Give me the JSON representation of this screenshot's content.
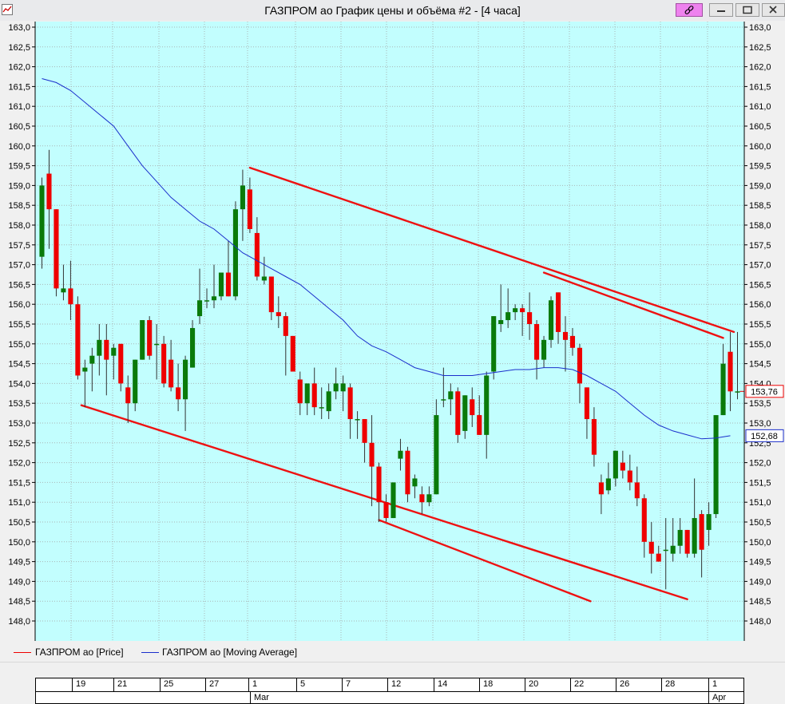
{
  "window": {
    "title": "ГАЗПРОМ ао График цены и объёма #2 - [4 часа]",
    "pin_icon": "link-icon",
    "minimize_icon": "minimize-icon",
    "maximize_icon": "restore-icon",
    "close_icon": "close-icon"
  },
  "legend": {
    "price_label": "ГАЗПРОМ ао [Price]",
    "ma_label": "ГАЗПРОМ ао [Moving Average]"
  },
  "colors": {
    "background": "#c2fefe",
    "up": "#0a7a0a",
    "down": "#ee0000",
    "ma": "#1a2ecc",
    "trendline": "#ee1111"
  },
  "chart_data": {
    "type": "candlestick",
    "ylim": [
      148.0,
      163.0
    ],
    "y_ticks": [
      "148,0",
      "148,5",
      "149,0",
      "149,5",
      "150,0",
      "150,5",
      "151,0",
      "151,5",
      "152,0",
      "152,5",
      "153,0",
      "153,5",
      "154,0",
      "154,5",
      "155,0",
      "155,5",
      "156,0",
      "156,5",
      "157,0",
      "157,5",
      "158,0",
      "158,5",
      "159,0",
      "159,5",
      "160,0",
      "160,5",
      "161,0",
      "161,5",
      "162,0",
      "162,5",
      "163,0"
    ],
    "x_day_labels": [
      "19",
      "21",
      "25",
      "27",
      "1",
      "5",
      "7",
      "12",
      "14",
      "18",
      "20",
      "22",
      "26",
      "28",
      "1"
    ],
    "x_month_labels": [
      "Mar",
      "Apr"
    ],
    "last_price_label": "153,76",
    "last_ma_label": "152,68",
    "grid": true,
    "candles": [
      {
        "o": 157.2,
        "h": 159.2,
        "l": 156.9,
        "c": 159.0
      },
      {
        "o": 159.3,
        "h": 159.9,
        "l": 157.4,
        "c": 158.4
      },
      {
        "o": 158.4,
        "h": 158.4,
        "l": 156.2,
        "c": 156.4
      },
      {
        "o": 156.3,
        "h": 157.0,
        "l": 156.1,
        "c": 156.4
      },
      {
        "o": 156.4,
        "h": 157.1,
        "l": 155.6,
        "c": 156.0
      },
      {
        "o": 156.0,
        "h": 156.2,
        "l": 154.1,
        "c": 154.2
      },
      {
        "o": 154.3,
        "h": 154.6,
        "l": 153.4,
        "c": 154.4
      },
      {
        "o": 154.5,
        "h": 154.9,
        "l": 153.8,
        "c": 154.7
      },
      {
        "o": 154.7,
        "h": 155.5,
        "l": 154.2,
        "c": 155.1
      },
      {
        "o": 155.1,
        "h": 155.5,
        "l": 153.7,
        "c": 154.6
      },
      {
        "o": 154.7,
        "h": 155.0,
        "l": 154.1,
        "c": 154.9
      },
      {
        "o": 155.0,
        "h": 155.0,
        "l": 153.8,
        "c": 154.0
      },
      {
        "o": 153.9,
        "h": 154.2,
        "l": 153.0,
        "c": 153.5
      },
      {
        "o": 153.5,
        "h": 154.6,
        "l": 153.3,
        "c": 154.6
      },
      {
        "o": 154.6,
        "h": 155.6,
        "l": 154.6,
        "c": 155.6
      },
      {
        "o": 155.6,
        "h": 155.7,
        "l": 154.6,
        "c": 154.7
      },
      {
        "o": 155.0,
        "h": 155.5,
        "l": 154.1,
        "c": 155.0
      },
      {
        "o": 155.0,
        "h": 155.2,
        "l": 153.9,
        "c": 154.0
      },
      {
        "o": 154.6,
        "h": 155.1,
        "l": 153.8,
        "c": 153.9
      },
      {
        "o": 153.9,
        "h": 154.5,
        "l": 153.3,
        "c": 153.6
      },
      {
        "o": 153.6,
        "h": 154.7,
        "l": 152.8,
        "c": 154.6
      },
      {
        "o": 154.4,
        "h": 155.6,
        "l": 154.4,
        "c": 155.4
      },
      {
        "o": 155.7,
        "h": 156.9,
        "l": 155.5,
        "c": 156.1
      },
      {
        "o": 156.1,
        "h": 156.4,
        "l": 155.9,
        "c": 156.1
      },
      {
        "o": 156.1,
        "h": 157.0,
        "l": 155.9,
        "c": 156.2
      },
      {
        "o": 156.2,
        "h": 156.8,
        "l": 156.1,
        "c": 156.8
      },
      {
        "o": 156.8,
        "h": 157.6,
        "l": 156.2,
        "c": 156.2
      },
      {
        "o": 156.2,
        "h": 158.6,
        "l": 156.1,
        "c": 158.4
      },
      {
        "o": 158.4,
        "h": 159.4,
        "l": 157.6,
        "c": 159.0
      },
      {
        "o": 158.9,
        "h": 159.2,
        "l": 157.8,
        "c": 157.9
      },
      {
        "o": 157.8,
        "h": 158.2,
        "l": 156.6,
        "c": 156.7
      },
      {
        "o": 156.6,
        "h": 157.2,
        "l": 156.5,
        "c": 156.7
      },
      {
        "o": 156.7,
        "h": 156.7,
        "l": 155.6,
        "c": 155.8
      },
      {
        "o": 155.8,
        "h": 156.2,
        "l": 155.4,
        "c": 155.7
      },
      {
        "o": 155.7,
        "h": 155.8,
        "l": 154.2,
        "c": 155.2
      },
      {
        "o": 155.2,
        "h": 155.2,
        "l": 154.3,
        "c": 154.3
      },
      {
        "o": 154.1,
        "h": 154.3,
        "l": 153.2,
        "c": 153.5
      },
      {
        "o": 153.5,
        "h": 154.0,
        "l": 153.2,
        "c": 154.0
      },
      {
        "o": 154.0,
        "h": 154.4,
        "l": 153.2,
        "c": 153.4
      },
      {
        "o": 153.4,
        "h": 153.9,
        "l": 153.1,
        "c": 153.4
      },
      {
        "o": 153.3,
        "h": 154.0,
        "l": 153.1,
        "c": 153.8
      },
      {
        "o": 153.8,
        "h": 154.4,
        "l": 153.6,
        "c": 154.0
      },
      {
        "o": 153.8,
        "h": 154.2,
        "l": 153.3,
        "c": 154.0
      },
      {
        "o": 153.9,
        "h": 154.0,
        "l": 152.6,
        "c": 153.1
      },
      {
        "o": 153.1,
        "h": 153.3,
        "l": 152.6,
        "c": 153.1
      },
      {
        "o": 153.1,
        "h": 153.1,
        "l": 152.0,
        "c": 152.5
      },
      {
        "o": 152.5,
        "h": 153.2,
        "l": 150.9,
        "c": 151.9
      },
      {
        "o": 151.9,
        "h": 152.0,
        "l": 150.5,
        "c": 151.0
      },
      {
        "o": 151.0,
        "h": 151.2,
        "l": 150.5,
        "c": 150.6
      },
      {
        "o": 150.6,
        "h": 151.5,
        "l": 150.6,
        "c": 151.5
      },
      {
        "o": 152.1,
        "h": 152.6,
        "l": 151.8,
        "c": 152.3
      },
      {
        "o": 152.3,
        "h": 152.4,
        "l": 151.0,
        "c": 151.2
      },
      {
        "o": 151.4,
        "h": 151.7,
        "l": 151.1,
        "c": 151.6
      },
      {
        "o": 151.2,
        "h": 151.4,
        "l": 150.7,
        "c": 151.0
      },
      {
        "o": 151.0,
        "h": 151.4,
        "l": 150.9,
        "c": 151.2
      },
      {
        "o": 151.2,
        "h": 153.6,
        "l": 151.2,
        "c": 153.2
      },
      {
        "o": 153.6,
        "h": 154.4,
        "l": 153.4,
        "c": 153.6
      },
      {
        "o": 153.6,
        "h": 154.0,
        "l": 153.2,
        "c": 153.8
      },
      {
        "o": 153.8,
        "h": 153.9,
        "l": 152.5,
        "c": 152.7
      },
      {
        "o": 152.8,
        "h": 153.7,
        "l": 152.6,
        "c": 153.7
      },
      {
        "o": 153.6,
        "h": 153.9,
        "l": 152.9,
        "c": 153.2
      },
      {
        "o": 153.2,
        "h": 153.7,
        "l": 152.7,
        "c": 152.7
      },
      {
        "o": 152.7,
        "h": 154.3,
        "l": 152.1,
        "c": 154.2
      },
      {
        "o": 154.3,
        "h": 155.7,
        "l": 154.1,
        "c": 155.7
      },
      {
        "o": 155.5,
        "h": 156.5,
        "l": 155.3,
        "c": 155.6
      },
      {
        "o": 155.6,
        "h": 156.4,
        "l": 155.4,
        "c": 155.8
      },
      {
        "o": 155.8,
        "h": 156.0,
        "l": 155.6,
        "c": 155.9
      },
      {
        "o": 155.9,
        "h": 156.0,
        "l": 155.2,
        "c": 155.8
      },
      {
        "o": 155.8,
        "h": 156.3,
        "l": 155.1,
        "c": 155.5
      },
      {
        "o": 155.5,
        "h": 155.6,
        "l": 154.1,
        "c": 154.6
      },
      {
        "o": 154.6,
        "h": 155.2,
        "l": 154.4,
        "c": 155.1
      },
      {
        "o": 155.1,
        "h": 156.2,
        "l": 154.9,
        "c": 156.1
      },
      {
        "o": 156.3,
        "h": 156.3,
        "l": 155.0,
        "c": 155.3
      },
      {
        "o": 155.3,
        "h": 155.7,
        "l": 154.3,
        "c": 155.1
      },
      {
        "o": 155.2,
        "h": 155.4,
        "l": 154.7,
        "c": 154.9
      },
      {
        "o": 154.9,
        "h": 155.0,
        "l": 153.5,
        "c": 154.0
      },
      {
        "o": 153.9,
        "h": 153.9,
        "l": 152.6,
        "c": 153.1
      },
      {
        "o": 153.1,
        "h": 153.4,
        "l": 151.9,
        "c": 152.2
      },
      {
        "o": 151.5,
        "h": 151.7,
        "l": 150.7,
        "c": 151.2
      },
      {
        "o": 151.3,
        "h": 152.0,
        "l": 151.2,
        "c": 151.6
      },
      {
        "o": 151.6,
        "h": 152.3,
        "l": 151.4,
        "c": 152.3
      },
      {
        "o": 152.0,
        "h": 152.3,
        "l": 151.6,
        "c": 151.8
      },
      {
        "o": 151.8,
        "h": 152.2,
        "l": 151.3,
        "c": 151.5
      },
      {
        "o": 151.5,
        "h": 151.9,
        "l": 150.9,
        "c": 151.1
      },
      {
        "o": 151.1,
        "h": 151.2,
        "l": 149.6,
        "c": 150.0
      },
      {
        "o": 150.0,
        "h": 150.5,
        "l": 149.2,
        "c": 149.7
      },
      {
        "o": 149.7,
        "h": 149.9,
        "l": 149.5,
        "c": 149.5
      },
      {
        "o": 149.8,
        "h": 150.6,
        "l": 148.8,
        "c": 149.8
      },
      {
        "o": 149.7,
        "h": 150.6,
        "l": 149.5,
        "c": 149.9
      },
      {
        "o": 149.9,
        "h": 150.6,
        "l": 149.7,
        "c": 150.3
      },
      {
        "o": 150.3,
        "h": 150.3,
        "l": 149.6,
        "c": 149.7
      },
      {
        "o": 149.7,
        "h": 151.6,
        "l": 149.6,
        "c": 150.6
      },
      {
        "o": 150.7,
        "h": 150.8,
        "l": 149.1,
        "c": 149.8
      },
      {
        "o": 150.3,
        "h": 151.0,
        "l": 149.9,
        "c": 150.7
      },
      {
        "o": 150.7,
        "h": 153.2,
        "l": 150.6,
        "c": 153.2
      },
      {
        "o": 153.2,
        "h": 155.0,
        "l": 153.2,
        "c": 154.5
      },
      {
        "o": 154.8,
        "h": 155.3,
        "l": 153.3,
        "c": 153.8
      },
      {
        "o": 153.8,
        "h": 155.3,
        "l": 153.6,
        "c": 153.8
      }
    ],
    "moving_average": [
      {
        "i": 0,
        "v": 161.7
      },
      {
        "i": 2,
        "v": 161.6
      },
      {
        "i": 4,
        "v": 161.4
      },
      {
        "i": 6,
        "v": 161.1
      },
      {
        "i": 8,
        "v": 160.8
      },
      {
        "i": 10,
        "v": 160.5
      },
      {
        "i": 12,
        "v": 160.0
      },
      {
        "i": 14,
        "v": 159.5
      },
      {
        "i": 16,
        "v": 159.1
      },
      {
        "i": 18,
        "v": 158.7
      },
      {
        "i": 20,
        "v": 158.4
      },
      {
        "i": 22,
        "v": 158.1
      },
      {
        "i": 24,
        "v": 157.9
      },
      {
        "i": 26,
        "v": 157.6
      },
      {
        "i": 28,
        "v": 157.3
      },
      {
        "i": 30,
        "v": 157.1
      },
      {
        "i": 32,
        "v": 156.9
      },
      {
        "i": 34,
        "v": 156.7
      },
      {
        "i": 36,
        "v": 156.5
      },
      {
        "i": 38,
        "v": 156.2
      },
      {
        "i": 40,
        "v": 155.9
      },
      {
        "i": 42,
        "v": 155.6
      },
      {
        "i": 44,
        "v": 155.2
      },
      {
        "i": 46,
        "v": 154.95
      },
      {
        "i": 48,
        "v": 154.8
      },
      {
        "i": 50,
        "v": 154.6
      },
      {
        "i": 52,
        "v": 154.4
      },
      {
        "i": 54,
        "v": 154.3
      },
      {
        "i": 56,
        "v": 154.2
      },
      {
        "i": 58,
        "v": 154.2
      },
      {
        "i": 60,
        "v": 154.2
      },
      {
        "i": 62,
        "v": 154.25
      },
      {
        "i": 64,
        "v": 154.3
      },
      {
        "i": 66,
        "v": 154.35
      },
      {
        "i": 68,
        "v": 154.35
      },
      {
        "i": 70,
        "v": 154.4
      },
      {
        "i": 72,
        "v": 154.4
      },
      {
        "i": 74,
        "v": 154.35
      },
      {
        "i": 76,
        "v": 154.2
      },
      {
        "i": 78,
        "v": 154.0
      },
      {
        "i": 80,
        "v": 153.8
      },
      {
        "i": 82,
        "v": 153.5
      },
      {
        "i": 84,
        "v": 153.2
      },
      {
        "i": 86,
        "v": 152.95
      },
      {
        "i": 88,
        "v": 152.8
      },
      {
        "i": 90,
        "v": 152.7
      },
      {
        "i": 92,
        "v": 152.6
      },
      {
        "i": 94,
        "v": 152.62
      },
      {
        "i": 96,
        "v": 152.68
      }
    ],
    "trendlines": [
      {
        "from": {
          "i": 5.5,
          "v": 153.45
        },
        "to": {
          "i": 90,
          "v": 148.55
        }
      },
      {
        "from": {
          "i": 47,
          "v": 150.55
        },
        "to": {
          "i": 76.5,
          "v": 148.5
        }
      },
      {
        "from": {
          "i": 29,
          "v": 159.45
        },
        "to": {
          "i": 96.5,
          "v": 155.3
        }
      },
      {
        "from": {
          "i": 70,
          "v": 156.8
        },
        "to": {
          "i": 95,
          "v": 155.15
        }
      }
    ]
  }
}
